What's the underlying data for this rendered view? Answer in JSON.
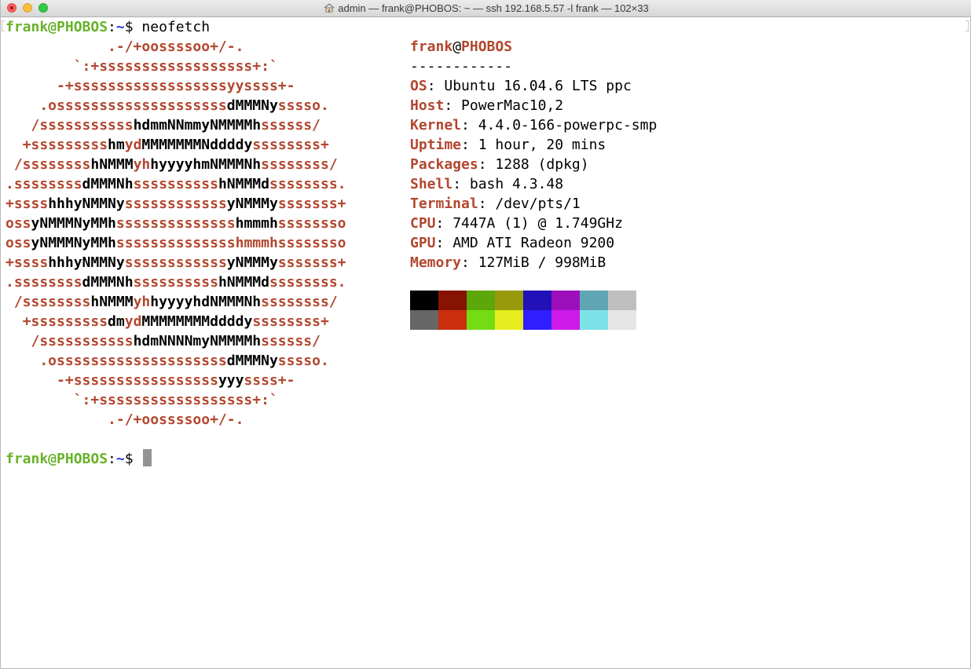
{
  "window": {
    "title": "admin — frank@PHOBOS: ~ — ssh 192.168.5.57 -l frank — 102×33",
    "icon": "home-icon"
  },
  "terminal": {
    "prompt_user": "frank@PHOBOS",
    "prompt_sep": ":",
    "prompt_path": "~",
    "prompt_sym": "$",
    "command": " neofetch",
    "logo": [
      [
        [
          "r",
          "            .-/+oossssoo+/-."
        ]
      ],
      [
        [
          "r",
          "        `:+ssssssssssssssssss+:`"
        ]
      ],
      [
        [
          "r",
          "      -+ssssssssssssssssssyyssss+-"
        ]
      ],
      [
        [
          "r",
          "    .ossssssssssssssssssss"
        ],
        [
          "b",
          "dMMMNy"
        ],
        [
          "r",
          "sssso."
        ]
      ],
      [
        [
          "r",
          "   /sssssssssss"
        ],
        [
          "b",
          "hdmmNNmmyNMMMMh"
        ],
        [
          "r",
          "ssssss/"
        ]
      ],
      [
        [
          "r",
          "  +sssssssss"
        ],
        [
          "b",
          "hm"
        ],
        [
          "r",
          "yd"
        ],
        [
          "b",
          "MMMMMMMNddddy"
        ],
        [
          "r",
          "ssssssss+"
        ]
      ],
      [
        [
          "r",
          " /ssssssss"
        ],
        [
          "b",
          "hNMMM"
        ],
        [
          "r",
          "yh"
        ],
        [
          "b",
          "hyyyyhmNMMMNh"
        ],
        [
          "r",
          "ssssssss/"
        ]
      ],
      [
        [
          "r",
          ".ssssssss"
        ],
        [
          "b",
          "dMMMNh"
        ],
        [
          "r",
          "ssssssssss"
        ],
        [
          "b",
          "hNMMMd"
        ],
        [
          "r",
          "ssssssss."
        ]
      ],
      [
        [
          "r",
          "+ssss"
        ],
        [
          "b",
          "hhhyNMMNy"
        ],
        [
          "r",
          "ssssssssssss"
        ],
        [
          "b",
          "yNMMMy"
        ],
        [
          "r",
          "sssssss+"
        ]
      ],
      [
        [
          "r",
          "oss"
        ],
        [
          "b",
          "yNMMMNyMMh"
        ],
        [
          "r",
          "ssssssssssssss"
        ],
        [
          "b",
          "hmmmh"
        ],
        [
          "r",
          "ssssssso"
        ]
      ],
      [
        [
          "r",
          "oss"
        ],
        [
          "b",
          "yNMMMNyMMh"
        ],
        [
          "r",
          "sssssssssssssshmmmhssssssso"
        ]
      ],
      [
        [
          "r",
          "+ssss"
        ],
        [
          "b",
          "hhhyNMMNy"
        ],
        [
          "r",
          "ssssssssssss"
        ],
        [
          "b",
          "yNMMMy"
        ],
        [
          "r",
          "sssssss+"
        ]
      ],
      [
        [
          "r",
          ".ssssssss"
        ],
        [
          "b",
          "dMMMNh"
        ],
        [
          "r",
          "ssssssssss"
        ],
        [
          "b",
          "hNMMMd"
        ],
        [
          "r",
          "ssssssss."
        ]
      ],
      [
        [
          "r",
          " /ssssssss"
        ],
        [
          "b",
          "hNMMM"
        ],
        [
          "r",
          "yh"
        ],
        [
          "b",
          "hyyyyhdNMMMNh"
        ],
        [
          "r",
          "ssssssss/"
        ]
      ],
      [
        [
          "r",
          "  +sssssssss"
        ],
        [
          "b",
          "dm"
        ],
        [
          "r",
          "yd"
        ],
        [
          "b",
          "MMMMMMMMddddy"
        ],
        [
          "r",
          "ssssssss+"
        ]
      ],
      [
        [
          "r",
          "   /sssssssssss"
        ],
        [
          "b",
          "hdmNNNNmyNMMMMh"
        ],
        [
          "r",
          "ssssss/"
        ]
      ],
      [
        [
          "r",
          "    .ossssssssssssssssssss"
        ],
        [
          "b",
          "dMMMNy"
        ],
        [
          "r",
          "sssso."
        ]
      ],
      [
        [
          "r",
          "      -+sssssssssssssssss"
        ],
        [
          "b",
          "yyy"
        ],
        [
          "r",
          "ssss+-"
        ]
      ],
      [
        [
          "r",
          "        `:+ssssssssssssssssss+:`"
        ]
      ],
      [
        [
          "r",
          "            .-/+oossssoo+/-."
        ]
      ]
    ],
    "info_header_user": "frank",
    "info_header_at": "@",
    "info_header_host": "PHOBOS",
    "info_divider": "------------",
    "info": [
      {
        "key": "OS",
        "value": "Ubuntu 16.04.6 LTS ppc"
      },
      {
        "key": "Host",
        "value": "PowerMac10,2"
      },
      {
        "key": "Kernel",
        "value": "4.4.0-166-powerpc-smp"
      },
      {
        "key": "Uptime",
        "value": "1 hour, 20 mins"
      },
      {
        "key": "Packages",
        "value": "1288 (dpkg)"
      },
      {
        "key": "Shell",
        "value": "bash 4.3.48"
      },
      {
        "key": "Terminal",
        "value": "/dev/pts/1"
      },
      {
        "key": "CPU",
        "value": "7447A (1) @ 1.749GHz"
      },
      {
        "key": "GPU",
        "value": "AMD ATI Radeon 9200"
      },
      {
        "key": "Memory",
        "value": "127MiB / 998MiB"
      }
    ],
    "palette_top": [
      "#000000",
      "#861400",
      "#5ca70a",
      "#989a0c",
      "#2211b7",
      "#9c0fbb",
      "#5fa5b4",
      "#bfbfbf"
    ],
    "palette_bottom": [
      "#666666",
      "#c92f0d",
      "#74dc12",
      "#e7ed20",
      "#2f1ffc",
      "#cf1aea",
      "#7ee3e8",
      "#e5e5e5"
    ]
  },
  "colors": {
    "prompt_green": "#68b22a",
    "prompt_blue": "#2f3bd9",
    "logo_rust": "#b2472f"
  }
}
